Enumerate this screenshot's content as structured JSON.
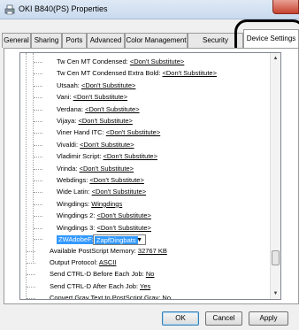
{
  "window": {
    "title": "OKI B840(PS) Properties"
  },
  "tabs": [
    {
      "label": "General"
    },
    {
      "label": "Sharing"
    },
    {
      "label": "Ports"
    },
    {
      "label": "Advanced"
    },
    {
      "label": "Color Management"
    },
    {
      "label": "Security"
    },
    {
      "label": "Device Settings"
    }
  ],
  "tree": {
    "font_rows": [
      {
        "name": "Tw Cen MT Condensed: ",
        "value": "<Don't Substitute>"
      },
      {
        "name": "Tw Cen MT Condensed Extra Bold: ",
        "value": "<Don't Substitute>"
      },
      {
        "name": "Utsaah: ",
        "value": "<Don't Substitute>"
      },
      {
        "name": "Vani: ",
        "value": "<Don't Substitute>"
      },
      {
        "name": "Verdana: ",
        "value": "<Don't Substitute>"
      },
      {
        "name": "Vijaya: ",
        "value": "<Don't Substitute>"
      },
      {
        "name": "Viner Hand ITC: ",
        "value": "<Don't Substitute>"
      },
      {
        "name": "Vivaldi: ",
        "value": "<Don't Substitute>"
      },
      {
        "name": "Vladimir Script: ",
        "value": "<Don't Substitute>"
      },
      {
        "name": "Vrinda: ",
        "value": "<Don't Substitute>"
      },
      {
        "name": "Webdings: ",
        "value": "<Don't Substitute>"
      },
      {
        "name": "Wide Latin: ",
        "value": "<Don't Substitute>"
      },
      {
        "name": "Wingdings: ",
        "value": "Wingdings"
      },
      {
        "name": "Wingdings 2: ",
        "value": "<Don't Substitute>"
      },
      {
        "name": "Wingdings 3: ",
        "value": "<Don't Substitute>"
      }
    ],
    "selected_row": {
      "name": "ZWAdobeF:",
      "value": "ZapfDingbats"
    },
    "setting_rows": [
      {
        "name": "Available PostScript Memory: ",
        "value": "32767 KB"
      },
      {
        "name": "Output Protocol: ",
        "value": "ASCII"
      },
      {
        "name": "Send CTRL-D Before Each Job: ",
        "value": "No"
      },
      {
        "name": "Send CTRL-D After Each Job: ",
        "value": "Yes"
      },
      {
        "name": "Convert Gray Text to PostScript Gray: ",
        "value": "No"
      }
    ]
  },
  "buttons": {
    "ok": "OK",
    "cancel": "Cancel",
    "apply": "Apply"
  },
  "colors": {
    "selection": "#3399ff",
    "title_bar": "#c9daee",
    "close_button": "#c7432f"
  }
}
